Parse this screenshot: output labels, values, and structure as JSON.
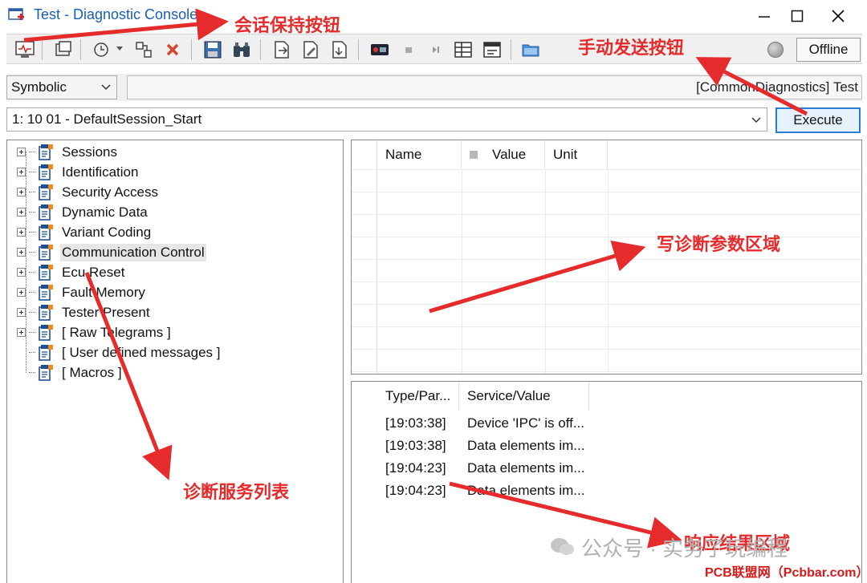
{
  "window": {
    "title": "Test - Diagnostic Console",
    "minimize_glyph": "—",
    "maximize_glyph": "☐",
    "close_glyph": "✕"
  },
  "toolbar": {
    "icons": [
      "console-icon",
      "window-icon",
      "history-icon",
      "connect-icon",
      "delete-icon",
      "save-icon",
      "search-binoculars-icon",
      "export-icon",
      "edit-icon",
      "import-icon",
      "tester-present-icon",
      "stop-icon",
      "step-icon",
      "grid-icon",
      "panel-icon",
      "folder-icon"
    ],
    "status": "Offline"
  },
  "mode": {
    "selected": "Symbolic"
  },
  "path_text": "[CommonDiagnostics] Test",
  "service": {
    "selected": "1: 10 01 - DefaultSession_Start",
    "execute_label": "Execute"
  },
  "tree": {
    "items": [
      {
        "label": "Sessions"
      },
      {
        "label": "Identification"
      },
      {
        "label": "Security Access"
      },
      {
        "label": "Dynamic Data"
      },
      {
        "label": "Variant Coding"
      },
      {
        "label": "Communication Control"
      },
      {
        "label": "Ecu Reset"
      },
      {
        "label": "Fault Memory"
      },
      {
        "label": "Tester Present"
      },
      {
        "label": "[ Raw Telegrams ]"
      },
      {
        "label": "[ User defined messages ]"
      },
      {
        "label": "[ Macros ]"
      }
    ]
  },
  "params": {
    "columns": [
      "Name",
      "Value",
      "Unit"
    ]
  },
  "results": {
    "columns": [
      "Type/Par...",
      "Service/Value"
    ],
    "rows": [
      {
        "time": "[19:03:38]",
        "text": "Device 'IPC' is off..."
      },
      {
        "time": "[19:03:38]",
        "text": "Data elements im..."
      },
      {
        "time": "[19:04:23]",
        "text": "Data elements im..."
      },
      {
        "time": "[19:04:23]",
        "text": "Data elements im..."
      }
    ]
  },
  "annotations": {
    "session_button": "会话保持按钮",
    "manual_send": "手动发送按钮",
    "write_params": "写诊断参数区域",
    "service_list": "诊断服务列表",
    "response_area": "响应结果区域"
  },
  "watermark": "公众号 · 实务了玩编程",
  "footer_mark": "PCB联盟网（Pcbbar.com）",
  "colors": {
    "annotation": "#e52b2b",
    "title": "#1a5fb4",
    "execute_border": "#2a7cd8"
  }
}
